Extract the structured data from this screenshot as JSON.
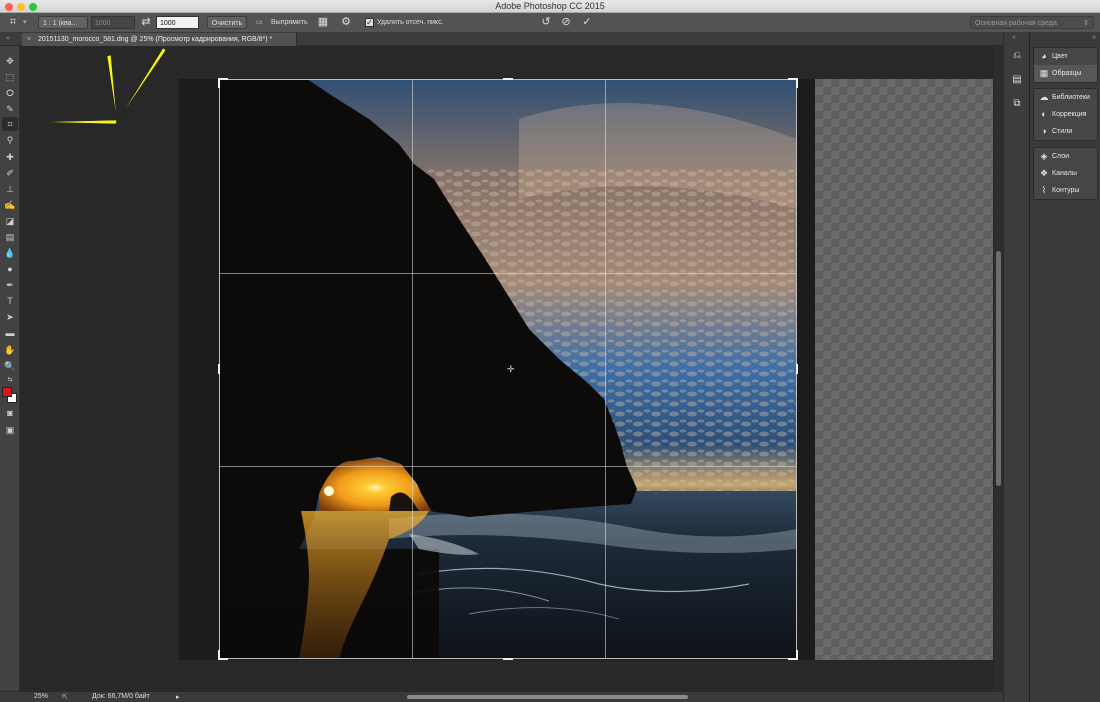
{
  "window": {
    "title": "Adobe Photoshop CC 2015",
    "workspace": "Основная рабочая среда"
  },
  "options_bar": {
    "ratio_preset": "1 : 1 (ква...",
    "width_placeholder": "1000",
    "height_value": "1000",
    "clear_label": "Очистить",
    "straighten_label": "Выпрямить",
    "delete_cropped_label": "Удалить отсеч. пикс.",
    "delete_cropped_checked": true
  },
  "document": {
    "tab_title": "20151130_morocco_581.dng @ 25% (Просмотр кадрирования, RGB/8*) *"
  },
  "status_bar": {
    "zoom": "25%",
    "doc_info": "Док: 66,7M/0 байт"
  },
  "panels": {
    "group1": [
      {
        "label": "Цвет",
        "icon": "color-wheel-icon"
      },
      {
        "label": "Образцы",
        "icon": "swatches-icon"
      }
    ],
    "group2": [
      {
        "label": "Библиотеки",
        "icon": "libraries-icon"
      },
      {
        "label": "Коррекция",
        "icon": "adjustments-icon"
      },
      {
        "label": "Стили",
        "icon": "styles-icon"
      }
    ],
    "group3": [
      {
        "label": "Слои",
        "icon": "layers-icon"
      },
      {
        "label": "Каналы",
        "icon": "channels-icon"
      },
      {
        "label": "Контуры",
        "icon": "paths-icon"
      }
    ]
  },
  "colors": {
    "foreground": "#e0141b",
    "background": "#ffffff",
    "annotation_arrow": "#f5f21c"
  }
}
